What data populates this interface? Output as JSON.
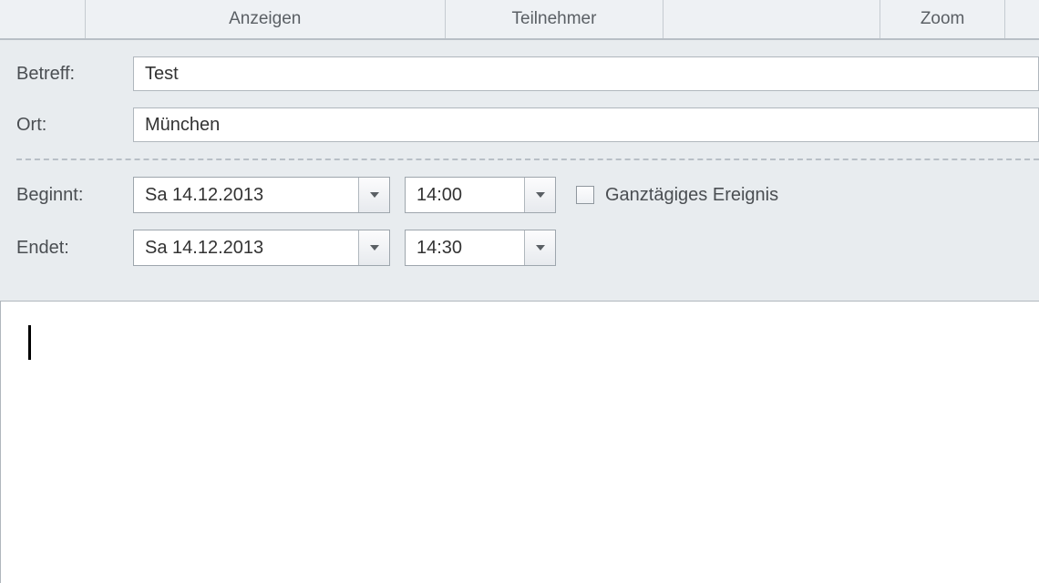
{
  "ribbon": {
    "anzeigen": "Anzeigen",
    "teilnehmer": "Teilnehmer",
    "zoom": "Zoom"
  },
  "labels": {
    "subject": "Betreff:",
    "location": "Ort:",
    "start": "Beginnt:",
    "end": "Endet:",
    "allday": "Ganztägiges Ereignis"
  },
  "fields": {
    "subject": "Test",
    "location": "München",
    "start_date": "Sa 14.12.2013",
    "start_time": "14:00",
    "end_date": "Sa 14.12.2013",
    "end_time": "14:30",
    "allday_checked": false
  },
  "body": ""
}
